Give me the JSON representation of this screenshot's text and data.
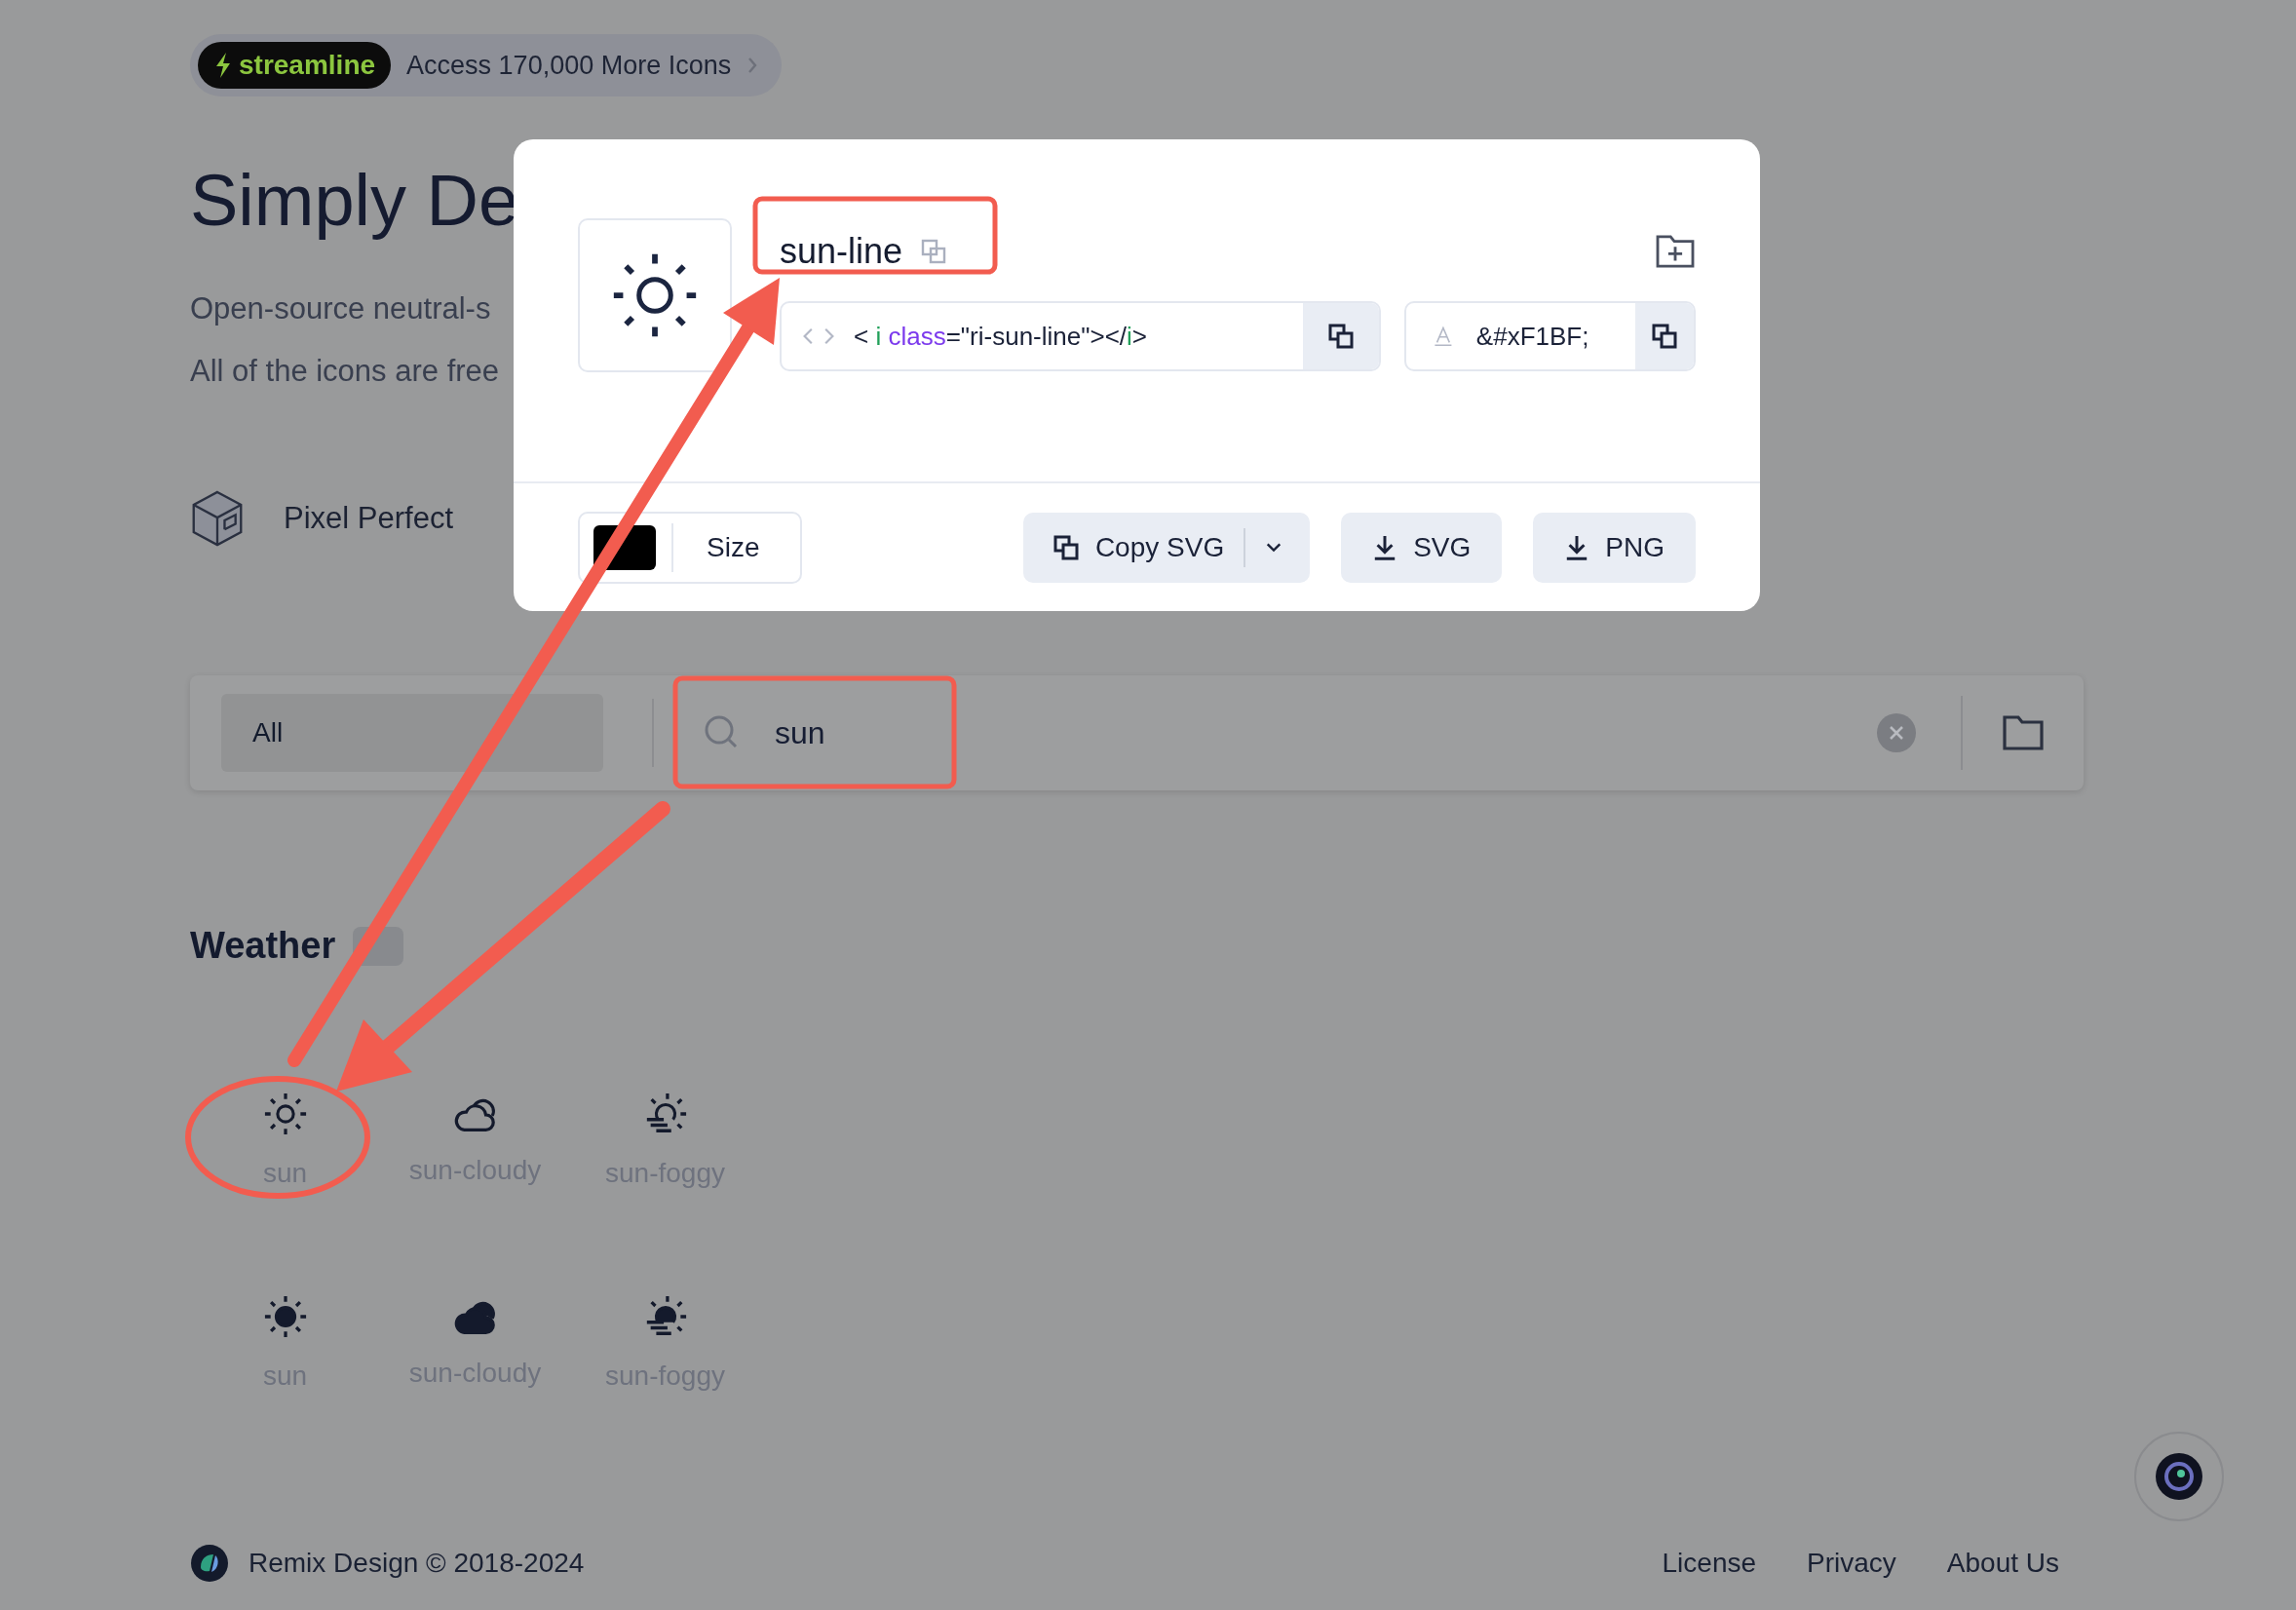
{
  "promo_banner": {
    "brand": "streamline",
    "text": "Access 170,000 More Icons"
  },
  "hero": {
    "title": "Simply De",
    "lines": [
      "Open-source neutral-s",
      "All of the icons are free"
    ],
    "feature": "Pixel Perfect"
  },
  "search_bar": {
    "category": "All",
    "query": "sun"
  },
  "section": {
    "title": "Weather",
    "icons": [
      {
        "name": "sun",
        "kind": "sun"
      },
      {
        "name": "sun-cloudy",
        "kind": "cloudy"
      },
      {
        "name": "sun-foggy",
        "kind": "foggy"
      },
      {
        "name": "sun",
        "kind": "solidsun"
      },
      {
        "name": "sun-cloudy",
        "kind": "solidcloudy"
      },
      {
        "name": "sun-foggy",
        "kind": "solidfoggy"
      }
    ]
  },
  "modal": {
    "icon_name": "sun-line",
    "code": [
      {
        "text": "< ",
        "kind": "plain"
      },
      {
        "text": "i",
        "kind": "tag"
      },
      {
        "text": " class",
        "kind": "attr"
      },
      {
        "text": "=\"ri-sun-line\"></",
        "kind": "plain"
      },
      {
        "text": "i",
        "kind": "tag"
      },
      {
        "text": ">",
        "kind": "plain"
      }
    ],
    "unicode": "&#xF1BF;",
    "color": "#000000",
    "size_label": "Size",
    "buttons": [
      {
        "label": "Copy SVG",
        "kind": "copy"
      },
      {
        "label": "SVG",
        "kind": "download"
      },
      {
        "label": "PNG",
        "kind": "download"
      }
    ]
  },
  "footer": {
    "brand": "Remix Design © 2018-2024",
    "links": [
      "License",
      "Privacy",
      "About Us"
    ]
  }
}
